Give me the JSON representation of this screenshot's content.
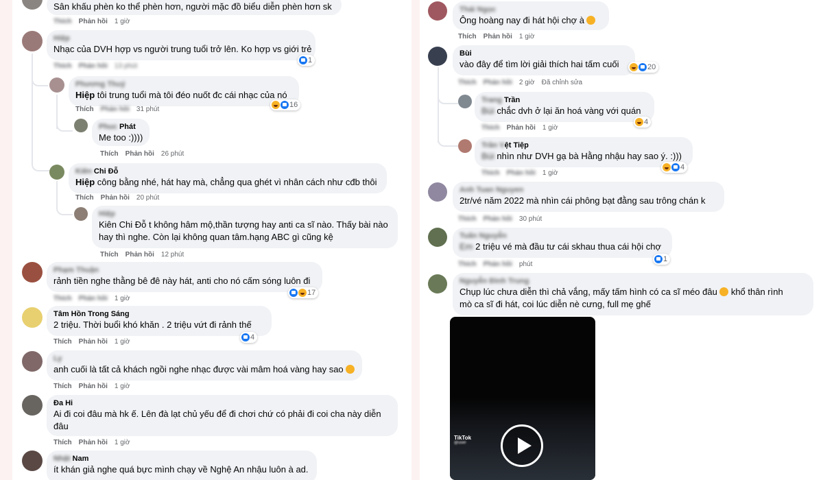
{
  "actions": {
    "like": "Thích",
    "reply": "Phản hồi",
    "edited": "Đã chỉnh sửa"
  },
  "left": [
    {
      "name": "",
      "text": "Sân khấu phèn ko thể phèn hơn, người mặc đồ biểu diễn phèn hơn sk",
      "time": "1 giờ"
    },
    {
      "name": "",
      "text": "Nhạc của DVH hợp vs người trung tuổi trở lên. Ko hợp vs giới trẻ",
      "time": "13 phút",
      "react": "1"
    },
    {
      "name": "",
      "tag": "Hiệp",
      "text": "tôi trung tuổi mà tôi đéo nuốt đc cái nhạc của nó",
      "time": "31 phút",
      "react": "16"
    },
    {
      "name": "Phát",
      "text": "Me too :))))",
      "time": "26 phút"
    },
    {
      "name": "Chi Đỗ",
      "tag": "Hiệp",
      "text": "công bằng nhé, hát hay mà, chẳng qua ghét vì nhân cách như cđb thôi",
      "time": "20 phút"
    },
    {
      "name": "",
      "tag": "Kiên Chi Đỗ",
      "text": "t không hâm mộ,thần tượng hay anti ca sĩ nào. Thấy bài nào",
      "text2": "hay thì nghe. Còn lại không quan tâm.hạng ABC gì cũng kệ",
      "time": "12 phút"
    },
    {
      "name": "",
      "text": "rảnh tiền nghe thằng bê đê này hát, anti cho nó cấm sóng luôn đi",
      "time": "1 giờ",
      "react": "17"
    },
    {
      "name": "Tâm Hồn Trong Sáng",
      "text": "2 triệu. Thời buổi khó khăn . 2 triệu vứt đi rảnh thế",
      "time": "1 giờ",
      "react": "4"
    },
    {
      "name": "",
      "text": "anh cuối là tất cả khách ngồi nghe nhạc được vài mâm hoá vàng hay sao",
      "time": "1 giờ"
    },
    {
      "name": "Đa Hi",
      "text": "Ai đi coi đâu mà hk ế. Lên đà lạt chủ yếu để đi chơi chứ có phải đi coi cha này diễn",
      "text2": "đâu",
      "time": "1 giờ"
    },
    {
      "name": "Nam",
      "text": "ít khán giả nghe quá bực mình chạy về Nghệ An nhậu luôn à ad."
    }
  ],
  "right": [
    {
      "name": "",
      "text": "Ông hoàng nay đi hát hội chợ à",
      "time": "1 giờ"
    },
    {
      "name": "Bùi",
      "text": "vào đây để tìm lời giải thích hai tấm cuối",
      "time": "2 giờ",
      "react": "20"
    },
    {
      "name": "Trần",
      "text": "chắc dvh ở lại ăn hoá vàng với quán",
      "time": "1 giờ",
      "react": "4"
    },
    {
      "name": "ệt Tiệp",
      "text": "nhìn như DVH gạ bà Hằng nhậu hay sao ý. :)))",
      "time": "1 giờ",
      "react": "4"
    },
    {
      "name": "",
      "text": "2tr/vé năm 2022 mà nhìn cái phông bạt đằng sau trông chán k",
      "time": "30 phút"
    },
    {
      "name": "",
      "text": "2 triệu vé mà đầu tư cái skhau thua cái hội chợ",
      "time": "phút",
      "react": "1"
    },
    {
      "name": "",
      "text": "Chụp lúc chưa diễn thì chả vắng, mấy tấm hình có ca sĩ méo đâu",
      "text_end": "khổ thân rình",
      "text2": "mò ca sĩ đi hát, coi lúc diễn nè cưng, full mẹ ghế"
    }
  ],
  "video": {
    "brand": "TikTok"
  },
  "colors": {
    "page_bg": "#fdf2f2",
    "bubble": "#f0f2f5",
    "meta": "#65676b",
    "like_blue": "#1877f2",
    "haha_yellow": "#f7b125"
  }
}
